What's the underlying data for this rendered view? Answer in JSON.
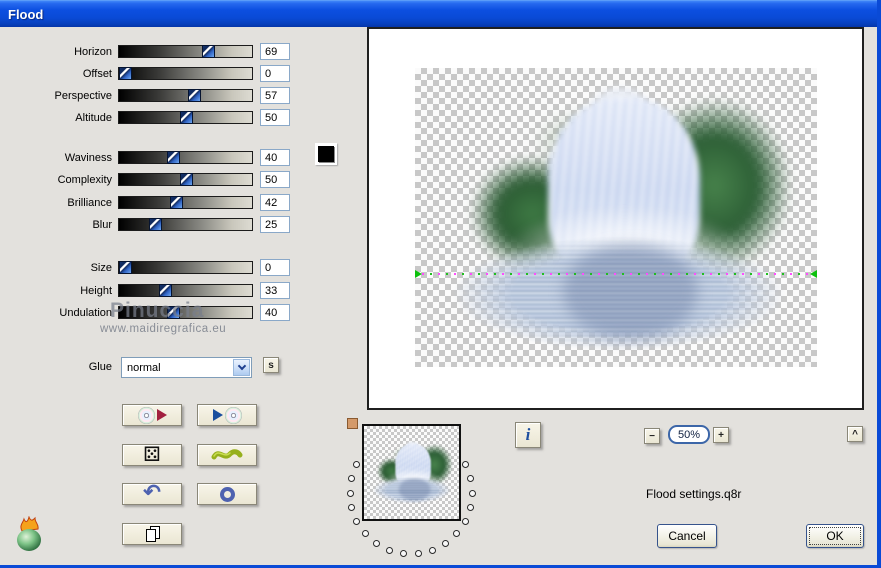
{
  "window": {
    "title": "Flood"
  },
  "panel": {
    "sliders": [
      {
        "label": "Horizon",
        "value": 69
      },
      {
        "label": "Offset",
        "value": 0
      },
      {
        "label": "Perspective",
        "value": 57
      },
      {
        "label": "Altitude",
        "value": 50
      },
      {
        "label": "Waviness",
        "value": 40
      },
      {
        "label": "Complexity",
        "value": 50
      },
      {
        "label": "Brilliance",
        "value": 42
      },
      {
        "label": "Blur",
        "value": 25
      },
      {
        "label": "Size",
        "value": 0
      },
      {
        "label": "Height",
        "value": 33
      },
      {
        "label": "Undulation",
        "value": 40
      }
    ],
    "glue_label": "Glue",
    "glue_value": "normal",
    "s_button": "s",
    "swatch_color": "#000000"
  },
  "watermark": {
    "name": "Pinuccia",
    "url": "www.maidiregrafica.eu"
  },
  "icons": {
    "die_glyph": "⚄",
    "undo_glyph": "↶",
    "info_glyph": "i"
  },
  "preview": {
    "zoom_level": "50%",
    "minus": "−",
    "plus": "+",
    "caret": "^",
    "settings_file": "Flood settings.q8r"
  },
  "actions": {
    "cancel": "Cancel",
    "ok": "OK"
  },
  "colors": {
    "title_bar": "#0a4ad6",
    "dialog_bg": "#e3e1dd",
    "checker": "#c8c8c8",
    "horizon_green": "#1fbf1f",
    "horizon_magenta": "#ff4bff"
  }
}
